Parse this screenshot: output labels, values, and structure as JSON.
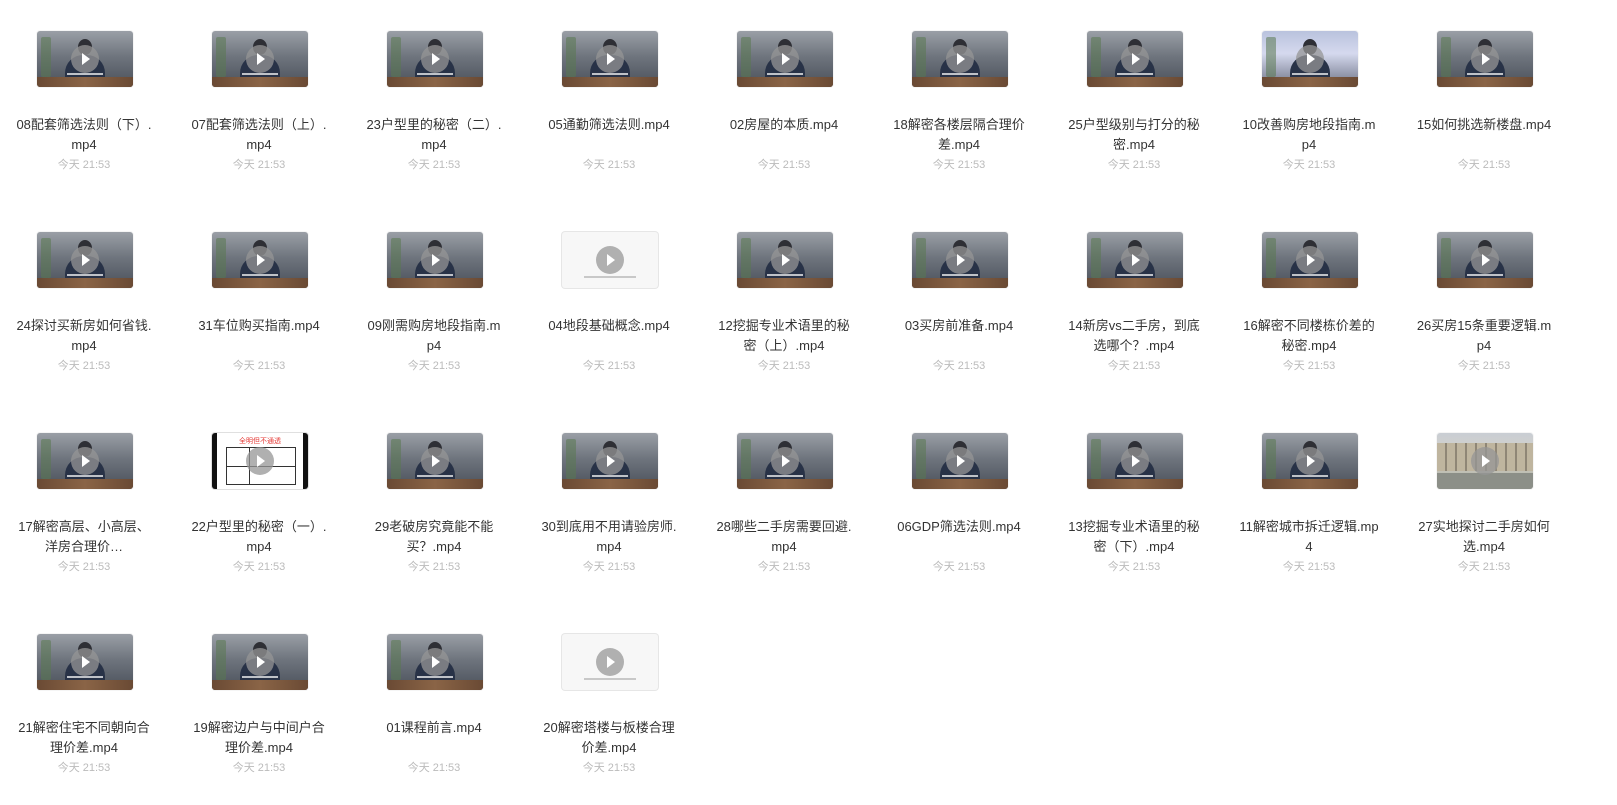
{
  "files": [
    {
      "name": "08配套筛选法则（下）.mp4",
      "time": "今天 21:53",
      "thumb": "talk"
    },
    {
      "name": "07配套筛选法则（上）.mp4",
      "time": "今天 21:53",
      "thumb": "talk"
    },
    {
      "name": "23户型里的秘密（二）.mp4",
      "time": "今天 21:53",
      "thumb": "talk"
    },
    {
      "name": "05通勤筛选法则.mp4",
      "time": "今天 21:53",
      "thumb": "talk"
    },
    {
      "name": "02房屋的本质.mp4",
      "time": "今天 21:53",
      "thumb": "talk"
    },
    {
      "name": "18解密各楼层隔合理价差.mp4",
      "time": "今天 21:53",
      "thumb": "talk"
    },
    {
      "name": "25户型级别与打分的秘密.mp4",
      "time": "今天 21:53",
      "thumb": "talk"
    },
    {
      "name": "10改善购房地段指南.mp4",
      "time": "今天 21:53",
      "thumb": "light"
    },
    {
      "name": "15如何挑选新楼盘.mp4",
      "time": "今天 21:53",
      "thumb": "talk"
    },
    {
      "name": "24探讨买新房如何省钱.mp4",
      "time": "今天 21:53",
      "thumb": "talk"
    },
    {
      "name": "31车位购买指南.mp4",
      "time": "今天 21:53",
      "thumb": "talk"
    },
    {
      "name": "09刚需购房地段指南.mp4",
      "time": "今天 21:53",
      "thumb": "talk"
    },
    {
      "name": "04地段基础概念.mp4",
      "time": "今天 21:53",
      "thumb": "blank"
    },
    {
      "name": "12挖掘专业术语里的秘密（上）.mp4",
      "time": "今天 21:53",
      "thumb": "talk"
    },
    {
      "name": "03买房前准备.mp4",
      "time": "今天 21:53",
      "thumb": "talk"
    },
    {
      "name": "14新房vs二手房，到底选哪个？.mp4",
      "time": "今天 21:53",
      "thumb": "talk"
    },
    {
      "name": "16解密不同楼栋价差的秘密.mp4",
      "time": "今天 21:53",
      "thumb": "talk"
    },
    {
      "name": "26买房15条重要逻辑.mp4",
      "time": "今天 21:53",
      "thumb": "talk"
    },
    {
      "name": "17解密高层、小高层、洋房合理价…",
      "time": "今天 21:53",
      "thumb": "talk"
    },
    {
      "name": "22户型里的秘密（一）.mp4",
      "time": "今天 21:53",
      "thumb": "plan",
      "thumb_text": "全明但不通透"
    },
    {
      "name": "29老破房究竟能不能买？.mp4",
      "time": "今天 21:53",
      "thumb": "talk"
    },
    {
      "name": "30到底用不用请验房师.mp4",
      "time": "今天 21:53",
      "thumb": "talk"
    },
    {
      "name": "28哪些二手房需要回避.mp4",
      "time": "今天 21:53",
      "thumb": "talk"
    },
    {
      "name": "06GDP筛选法则.mp4",
      "time": "今天 21:53",
      "thumb": "talk"
    },
    {
      "name": "13挖掘专业术语里的秘密（下）.mp4",
      "time": "今天 21:53",
      "thumb": "talk"
    },
    {
      "name": "11解密城市拆迁逻辑.mp4",
      "time": "今天 21:53",
      "thumb": "talk"
    },
    {
      "name": "27实地探讨二手房如何选.mp4",
      "time": "今天 21:53",
      "thumb": "street"
    },
    {
      "name": "21解密住宅不同朝向合理价差.mp4",
      "time": "今天 21:53",
      "thumb": "talk"
    },
    {
      "name": "19解密边户与中间户合理价差.mp4",
      "time": "今天 21:53",
      "thumb": "talk"
    },
    {
      "name": "01课程前言.mp4",
      "time": "今天 21:53",
      "thumb": "talk"
    },
    {
      "name": "20解密塔楼与板楼合理价差.mp4",
      "time": "今天 21:53",
      "thumb": "blank"
    }
  ]
}
